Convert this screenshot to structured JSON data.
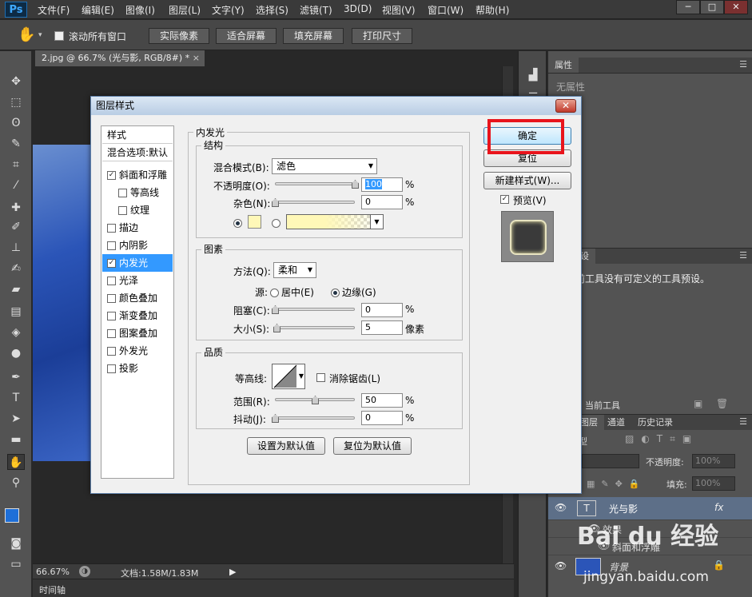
{
  "app": {
    "logo": "Ps"
  },
  "menu": [
    "文件(F)",
    "编辑(E)",
    "图像(I)",
    "图层(L)",
    "文字(Y)",
    "选择(S)",
    "滤镜(T)",
    "3D(D)",
    "视图(V)",
    "窗口(W)",
    "帮助(H)"
  ],
  "window_controls": {
    "min": "─",
    "max": "□",
    "close": "✕"
  },
  "options_bar": {
    "scroll_all": "滚动所有窗口",
    "buttons": [
      "实际像素",
      "适合屏幕",
      "填充屏幕",
      "打印尺寸"
    ]
  },
  "document": {
    "tab_title": "2.jpg @ 66.7% (光与影, RGB/8#) *",
    "tab_close": "×",
    "zoom": "66.67%",
    "doc_size": "文档:1.58M/1.83M",
    "timeline": "时间轴"
  },
  "right_panel": {
    "properties_tab": "属性",
    "no_properties": "无属性",
    "tool_preset_tab": "设",
    "tool_preset_msg": "前工具没有可定义的工具预设。",
    "current_tool": "当前工具",
    "tabs": [
      "图层",
      "通道",
      "历史记录"
    ],
    "kind_label": "型",
    "opacity_label": "不透明度:",
    "opacity_value": "100%",
    "fill_label": "填充:",
    "fill_value": "100%",
    "layers": [
      {
        "name": "光与影",
        "badge": "fx"
      },
      {
        "name": "效果"
      },
      {
        "name": "斜面和浮雕"
      },
      {
        "name": "背景"
      }
    ]
  },
  "dialog": {
    "title": "图层样式",
    "close": "✕",
    "style_header": "样式",
    "blend_options": "混合选项:默认",
    "styles": [
      {
        "label": "斜面和浮雕",
        "checked": true
      },
      {
        "label": "等高线",
        "checked": false
      },
      {
        "label": "纹理",
        "checked": false
      },
      {
        "label": "描边",
        "checked": false
      },
      {
        "label": "内阴影",
        "checked": false
      },
      {
        "label": "内发光",
        "checked": true
      },
      {
        "label": "光泽",
        "checked": false
      },
      {
        "label": "颜色叠加",
        "checked": false
      },
      {
        "label": "渐变叠加",
        "checked": false
      },
      {
        "label": "图案叠加",
        "checked": false
      },
      {
        "label": "外发光",
        "checked": false
      },
      {
        "label": "投影",
        "checked": false
      }
    ],
    "check_mark": "✓",
    "section_title": "内发光",
    "structure": {
      "title": "结构",
      "blend_mode_label": "混合模式(B):",
      "blend_mode": "滤色",
      "opacity_label": "不透明度(O):",
      "opacity": "100",
      "noise_label": "杂色(N):",
      "noise": "0",
      "percent": "%",
      "glow_color": "#fff8b8",
      "opacity_level": 1.0,
      "noise_level": 0.0
    },
    "elements": {
      "title": "图素",
      "technique_label": "方法(Q):",
      "technique": "柔和",
      "source_label": "源:",
      "center": "居中(E)",
      "edge": "边缘(G)",
      "choke_label": "阻塞(C):",
      "choke": "0",
      "size_label": "大小(S):",
      "size": "5",
      "px": "像素",
      "choke_level": 0.0,
      "size_level": 0.02
    },
    "quality": {
      "title": "品质",
      "contour_label": "等高线:",
      "antialias": "消除锯齿(L)",
      "range_label": "范围(R):",
      "range": "50",
      "jitter_label": "抖动(J):",
      "jitter": "0",
      "range_level": 0.5,
      "jitter_level": 0.0
    },
    "make_default": "设置为默认值",
    "reset_default": "复位为默认值",
    "ok": "确定",
    "reset": "复位",
    "new_style": "新建样式(W)...",
    "preview": "预览(V)"
  },
  "watermark": {
    "brand": "Bai du 经验",
    "url": "jingyan.baidu.com"
  },
  "colors": {
    "highlight": "#e8141c",
    "selection": "#3399ff",
    "fg_color": "#1e6fd8"
  }
}
